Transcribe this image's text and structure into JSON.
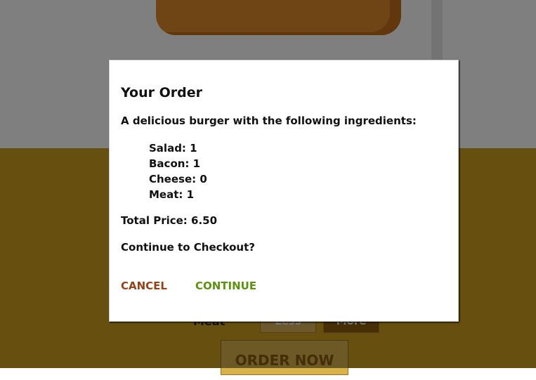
{
  "app": {
    "bottom_control": {
      "label": "Meat",
      "less_label": "Less",
      "more_label": "More"
    },
    "order_button_label": "ORDER NOW"
  },
  "modal": {
    "title": "Your Order",
    "description": "A delicious burger with the following ingredients:",
    "ingredients": [
      {
        "text": "Salad: 1"
      },
      {
        "text": "Bacon: 1"
      },
      {
        "text": "Cheese: 0"
      },
      {
        "text": "Meat: 1"
      }
    ],
    "total_price": "Total Price: 6.50",
    "question": "Continue to Checkout?",
    "cancel_label": "CANCEL",
    "continue_label": "CONTINUE"
  },
  "colors": {
    "controls_background": "#cf9f1f",
    "bread": "#e08a2a",
    "cancel": "#944317",
    "continue": "#5c9210"
  }
}
